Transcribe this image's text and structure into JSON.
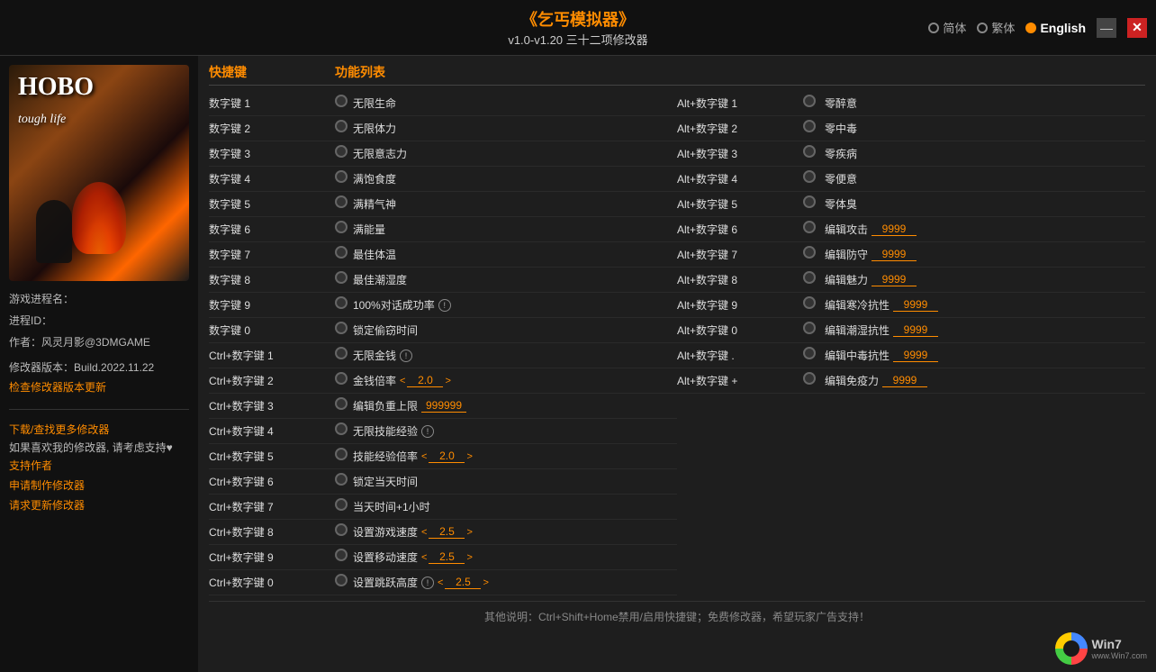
{
  "header": {
    "title_main": "《乞丐模拟器》",
    "title_sub": "v1.0-v1.20 三十二项修改器",
    "lang_simplified": "简体",
    "lang_traditional": "繁体",
    "lang_english": "English",
    "minimize_label": "—",
    "close_label": "✕"
  },
  "left_panel": {
    "game_title_line1": "HOBO",
    "game_title_line2": "tough life",
    "process_label": "游戏进程名：",
    "process_id_label": "进程ID：",
    "author_label": "作者：风灵月影@3DMGAME",
    "version_label": "修改器版本：Build.2022.11.22",
    "check_update_link": "检查修改器版本更新",
    "download_link": "下载/查找更多修改器",
    "support_text": "如果喜欢我的修改器, 请考虑支持♥",
    "support_author_link": "支持作者",
    "request_trainer_link": "申请制作修改器",
    "request_update_link": "请求更新修改器"
  },
  "table": {
    "col1_header": "快捷键",
    "col2_header": "功能列表",
    "left_rows": [
      {
        "shortcut": "数字键 1",
        "feature": "无限生命",
        "has_info": false,
        "has_value": false
      },
      {
        "shortcut": "数字键 2",
        "feature": "无限体力",
        "has_info": false,
        "has_value": false
      },
      {
        "shortcut": "数字键 3",
        "feature": "无限意志力",
        "has_info": false,
        "has_value": false
      },
      {
        "shortcut": "数字键 4",
        "feature": "满饱食度",
        "has_info": false,
        "has_value": false
      },
      {
        "shortcut": "数字键 5",
        "feature": "满精气神",
        "has_info": false,
        "has_value": false
      },
      {
        "shortcut": "数字键 6",
        "feature": "满能量",
        "has_info": false,
        "has_value": false
      },
      {
        "shortcut": "数字键 7",
        "feature": "最佳体温",
        "has_info": false,
        "has_value": false
      },
      {
        "shortcut": "数字键 8",
        "feature": "最佳潮湿度",
        "has_info": false,
        "has_value": false
      },
      {
        "shortcut": "数字键 9",
        "feature": "100%对话成功率",
        "has_info": true,
        "has_value": false
      },
      {
        "shortcut": "数字键 0",
        "feature": "锁定偷窃时间",
        "has_info": false,
        "has_value": false
      },
      {
        "shortcut": "Ctrl+数字键 1",
        "feature": "无限金钱",
        "has_info": true,
        "has_value": false
      },
      {
        "shortcut": "Ctrl+数字键 2",
        "feature": "金钱倍率",
        "has_info": false,
        "has_value": true,
        "value": "2.0"
      },
      {
        "shortcut": "Ctrl+数字键 3",
        "feature": "编辑负重上限",
        "has_info": false,
        "has_value": false,
        "edit_value": "999999"
      },
      {
        "shortcut": "Ctrl+数字键 4",
        "feature": "无限技能经验",
        "has_info": true,
        "has_value": false
      },
      {
        "shortcut": "Ctrl+数字键 5",
        "feature": "技能经验倍率",
        "has_info": false,
        "has_value": true,
        "value": "2.0"
      },
      {
        "shortcut": "Ctrl+数字键 6",
        "feature": "锁定当天时间",
        "has_info": false,
        "has_value": false
      },
      {
        "shortcut": "Ctrl+数字键 7",
        "feature": "当天时间+1小时",
        "has_info": false,
        "has_value": false
      },
      {
        "shortcut": "Ctrl+数字键 8",
        "feature": "设置游戏速度",
        "has_info": false,
        "has_value": true,
        "value": "2.5"
      },
      {
        "shortcut": "Ctrl+数字键 9",
        "feature": "设置移动速度",
        "has_info": false,
        "has_value": true,
        "value": "2.5"
      },
      {
        "shortcut": "Ctrl+数字键 0",
        "feature": "设置跳跃高度",
        "has_info": true,
        "has_value": true,
        "value": "2.5"
      }
    ],
    "right_rows": [
      {
        "shortcut": "Alt+数字键 1",
        "feature": "零醉意",
        "has_value": false
      },
      {
        "shortcut": "Alt+数字键 2",
        "feature": "零中毒",
        "has_value": false
      },
      {
        "shortcut": "Alt+数字键 3",
        "feature": "零疾病",
        "has_value": false
      },
      {
        "shortcut": "Alt+数字键 4",
        "feature": "零便意",
        "has_value": false
      },
      {
        "shortcut": "Alt+数字键 5",
        "feature": "零体臭",
        "has_value": false
      },
      {
        "shortcut": "Alt+数字键 6",
        "feature": "编辑攻击",
        "has_value": true,
        "edit_value": "9999"
      },
      {
        "shortcut": "Alt+数字键 7",
        "feature": "编辑防守",
        "has_value": true,
        "edit_value": "9999"
      },
      {
        "shortcut": "Alt+数字键 8",
        "feature": "编辑魅力",
        "has_value": true,
        "edit_value": "9999"
      },
      {
        "shortcut": "Alt+数字键 9",
        "feature": "编辑寒冷抗性",
        "has_value": true,
        "edit_value": "9999"
      },
      {
        "shortcut": "Alt+数字键 0",
        "feature": "编辑潮湿抗性",
        "has_value": true,
        "edit_value": "9999"
      },
      {
        "shortcut": "Alt+数字键 .",
        "feature": "编辑中毒抗性",
        "has_value": true,
        "edit_value": "9999"
      },
      {
        "shortcut": "Alt+数字键 +",
        "feature": "编辑免疫力",
        "has_value": true,
        "edit_value": "9999"
      }
    ],
    "footer_note": "其他说明：Ctrl+Shift+Home禁用/启用快捷键；免费修改器，希望玩家广告支持！"
  },
  "win7": {
    "text": "Win7",
    "subtext": "www.Win7.com"
  }
}
